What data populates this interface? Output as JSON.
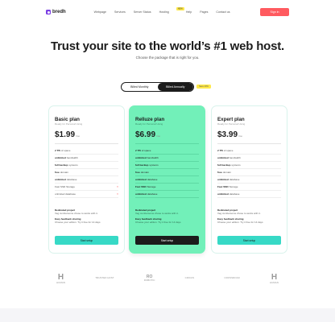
{
  "header": {
    "brand": "bredh",
    "menu": [
      "Webpage",
      "Services",
      "Server Status",
      "Hosting",
      "Help",
      "Pages",
      "Contact us"
    ],
    "new_badge": "NEW",
    "signin": "Sign in"
  },
  "hero": {
    "title": "Trust your site to the world’s #1 web host.",
    "subtitle": "Choose the package that is right for you."
  },
  "billing": {
    "options": [
      "Billed Monthly",
      "Billed Annually"
    ],
    "selected": "Billed Annually",
    "discount": "Save 40%"
  },
  "plans": [
    {
      "name": "Basic plan",
      "desc": "Ready for Personal Using",
      "price": "$1.99",
      "period": "/mo",
      "features": [
        {
          "bold": "2 TB",
          "text": "of space",
          "included": true
        },
        {
          "bold": "unlimited",
          "text": "bandwidth",
          "included": true
        },
        {
          "bold": "full backup",
          "text": "systems",
          "included": true
        },
        {
          "bold": "free",
          "text": "domain",
          "included": true
        },
        {
          "bold": "unlimited",
          "text": "database",
          "included": true
        },
        {
          "bold": "",
          "text": "Fast SSD Storage",
          "included": false
        },
        {
          "bold": "",
          "text": "unlimited database",
          "included": false
        }
      ],
      "extras": [
        {
          "title": "Dedicated project",
          "text": "Veg cumbersome chose to works with it."
        },
        {
          "title": "Easy feedback sharing",
          "text": "Choose your edition. Try it free for 14 days"
        }
      ],
      "cta": "Start setup"
    },
    {
      "name": "Relluze plan",
      "desc": "Ready for Personal Using",
      "price": "$6.99",
      "period": "/mo",
      "features": [
        {
          "bold": "2 TB",
          "text": "of space",
          "included": true
        },
        {
          "bold": "unlimited",
          "text": "bandwidth",
          "included": true
        },
        {
          "bold": "full backup",
          "text": "systems",
          "included": true
        },
        {
          "bold": "free",
          "text": "domain",
          "included": true
        },
        {
          "bold": "unlimited",
          "text": "database",
          "included": true
        },
        {
          "bold": "Fast SSD",
          "text": "Storage",
          "included": true
        },
        {
          "bold": "unlimited",
          "text": "database",
          "included": true
        }
      ],
      "extras": [
        {
          "title": "Dedicated project",
          "text": "Veg cumbersome chose to works with it."
        },
        {
          "title": "Easy feedback sharing",
          "text": "Choose your edition. Try it free for 14 days"
        }
      ],
      "cta": "Start setup"
    },
    {
      "name": "Expert plan",
      "desc": "Ready for Personal Using",
      "price": "$3.99",
      "period": "/mo",
      "features": [
        {
          "bold": "2 TB",
          "text": "of space",
          "included": true
        },
        {
          "bold": "unlimited",
          "text": "bandwidth",
          "included": true
        },
        {
          "bold": "full backup",
          "text": "systems",
          "included": true
        },
        {
          "bold": "free",
          "text": "domain",
          "included": true
        },
        {
          "bold": "unlimited",
          "text": "database",
          "included": true
        },
        {
          "bold": "Fast SSD",
          "text": "Storage",
          "included": true
        },
        {
          "bold": "unlimited",
          "text": "database",
          "included": true
        }
      ],
      "extras": [
        {
          "title": "Dedicated project",
          "text": "Veg cumbersome chose to works with it."
        },
        {
          "title": "Easy feedback sharing",
          "text": "Choose your edition. Try it free for 14 days"
        }
      ],
      "cta": "Start setup"
    }
  ],
  "client_logos": [
    {
      "main": "H",
      "sub": "HUMAN"
    },
    {
      "main": "",
      "sub": "TRUSTED HOST"
    },
    {
      "main": "RO",
      "sub": "ROBOTIC"
    },
    {
      "main": "",
      "sub": "CIRCUS"
    },
    {
      "main": "",
      "sub": "CROSSROAD"
    },
    {
      "main": "H",
      "sub": "HUMAN"
    }
  ],
  "colors": {
    "accent": "#ff5a5f",
    "brand": "#7b3fe4",
    "highlight_card": "#72f0b9",
    "cta": "#37d9c6",
    "dark": "#1c1c1c"
  }
}
